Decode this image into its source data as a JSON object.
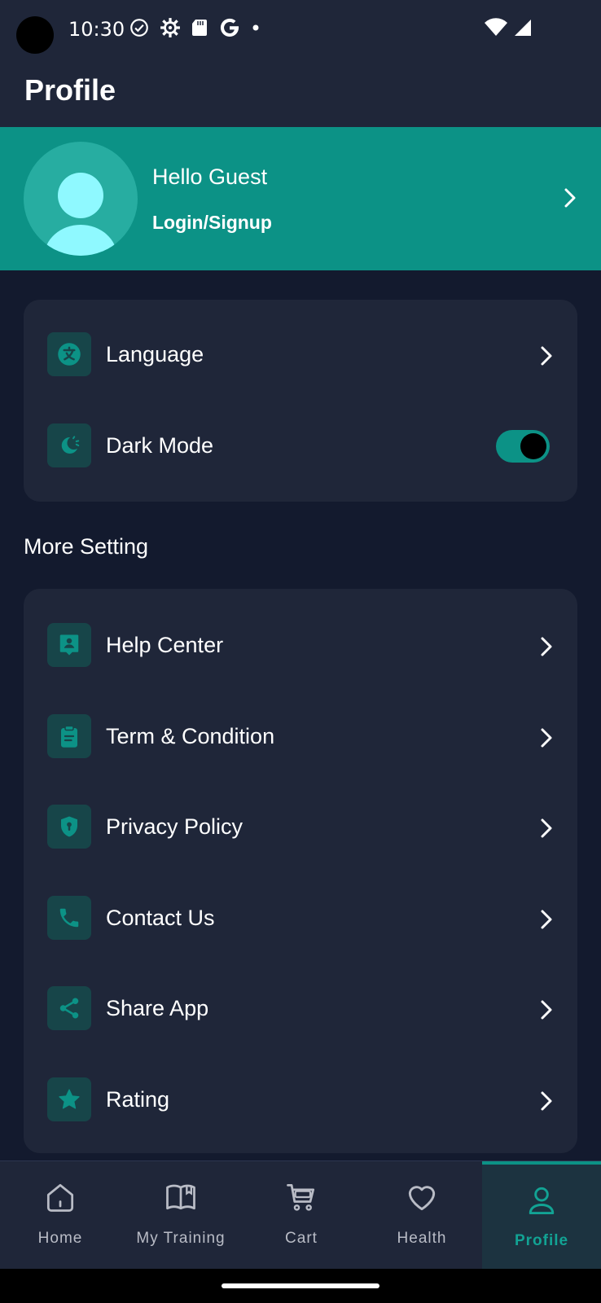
{
  "status_bar": {
    "time": "10:30"
  },
  "header": {
    "title": "Profile"
  },
  "profile": {
    "greeting": "Hello Guest",
    "login_label": "Login/Signup"
  },
  "preferences": {
    "items": [
      {
        "label": "Language",
        "icon": "translate-icon"
      },
      {
        "label": "Dark Mode",
        "icon": "moon-icon",
        "toggle_on": true
      }
    ]
  },
  "more_settings": {
    "title": "More Setting",
    "items": [
      {
        "label": "Help Center",
        "icon": "help-center-icon"
      },
      {
        "label": "Term & Condition",
        "icon": "clipboard-icon"
      },
      {
        "label": "Privacy Policy",
        "icon": "shield-icon"
      },
      {
        "label": "Contact Us",
        "icon": "phone-icon"
      },
      {
        "label": "Share App",
        "icon": "share-icon"
      },
      {
        "label": "Rating",
        "icon": "star-icon"
      }
    ]
  },
  "bottom_nav": {
    "items": [
      {
        "label": "Home",
        "icon": "home-icon"
      },
      {
        "label": "My Training",
        "icon": "book-icon"
      },
      {
        "label": "Cart",
        "icon": "cart-icon"
      },
      {
        "label": "Health",
        "icon": "heart-icon"
      },
      {
        "label": "Profile",
        "icon": "user-icon",
        "active": true
      }
    ]
  },
  "colors": {
    "accent": "#0c9286",
    "background": "#131a2e",
    "card": "#1f2639",
    "icon_tile": "#174549"
  }
}
